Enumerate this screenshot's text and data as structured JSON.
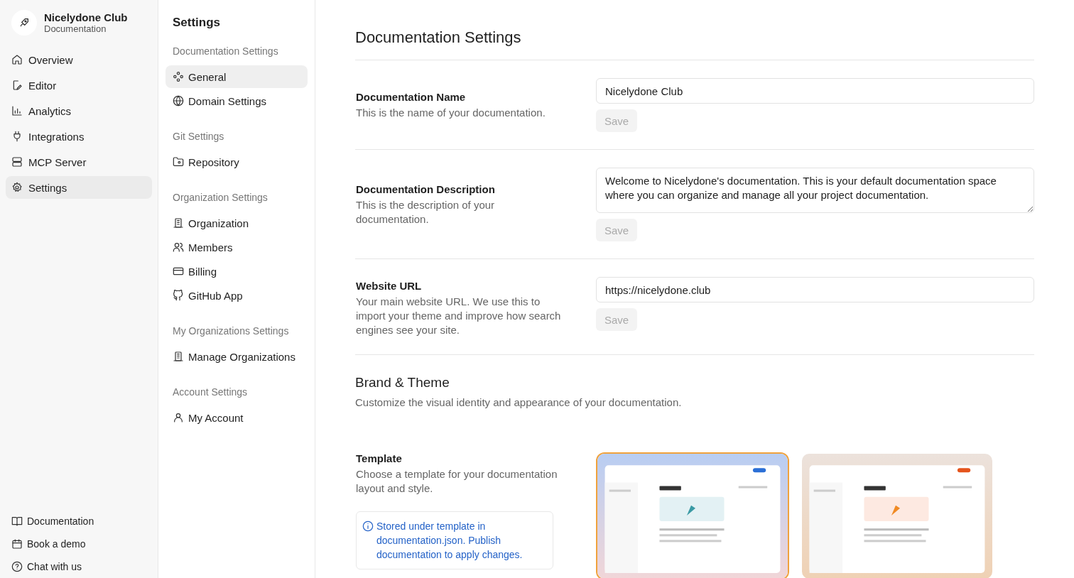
{
  "sidebar": {
    "org_name": "Nicelydone Club",
    "org_subtitle": "Documentation",
    "items": [
      {
        "label": "Overview",
        "selected": false
      },
      {
        "label": "Editor",
        "selected": false
      },
      {
        "label": "Analytics",
        "selected": false
      },
      {
        "label": "Integrations",
        "selected": false
      },
      {
        "label": "MCP Server",
        "selected": false
      },
      {
        "label": "Settings",
        "selected": true
      }
    ],
    "footer_links": [
      {
        "label": "Documentation"
      },
      {
        "label": "Book a demo"
      },
      {
        "label": "Chat with us"
      }
    ]
  },
  "settings_nav": {
    "title": "Settings",
    "groups": [
      {
        "label": "Documentation Settings",
        "items": [
          {
            "label": "General",
            "selected": true
          },
          {
            "label": "Domain Settings",
            "selected": false
          }
        ]
      },
      {
        "label": "Git Settings",
        "items": [
          {
            "label": "Repository",
            "selected": false
          }
        ]
      },
      {
        "label": "Organization Settings",
        "items": [
          {
            "label": "Organization",
            "selected": false
          },
          {
            "label": "Members",
            "selected": false
          },
          {
            "label": "Billing",
            "selected": false
          },
          {
            "label": "GitHub App",
            "selected": false
          }
        ]
      },
      {
        "label": "My Organizations Settings",
        "items": [
          {
            "label": "Manage Organizations",
            "selected": false
          }
        ]
      },
      {
        "label": "Account Settings",
        "items": [
          {
            "label": "My Account",
            "selected": false
          }
        ]
      }
    ]
  },
  "main": {
    "title": "Documentation Settings",
    "fields": [
      {
        "label": "Documentation Name",
        "description": "This is the name of your documentation.",
        "kind": "input",
        "value": "Nicelydone Club",
        "save": {
          "label": "Save",
          "disabled": true
        }
      },
      {
        "label": "Documentation Description",
        "description": "This is the description of your documentation.",
        "kind": "textarea",
        "value": "Welcome to Nicelydone's documentation. This is your default documentation space where you can organize and manage all your project documentation.",
        "save": {
          "label": "Save",
          "disabled": true
        }
      },
      {
        "label": "Website URL",
        "description": "Your main website URL. We use this to import your theme and improve how search engines see your site.",
        "kind": "input",
        "value": "https://nicelydone.club",
        "save": {
          "label": "Save",
          "disabled": true
        }
      }
    ],
    "brand": {
      "title": "Brand & Theme",
      "subtitle": "Customize the visual identity and appearance of your documentation.",
      "template": {
        "label": "Template",
        "description": "Choose a template for your documentation layout and style.",
        "info": "Stored under template in documentation.json. Publish documentation to apply changes.",
        "options": [
          {
            "kind": "picture",
            "selected": true
          },
          {
            "kind": "picture",
            "selected": false
          }
        ]
      }
    }
  }
}
